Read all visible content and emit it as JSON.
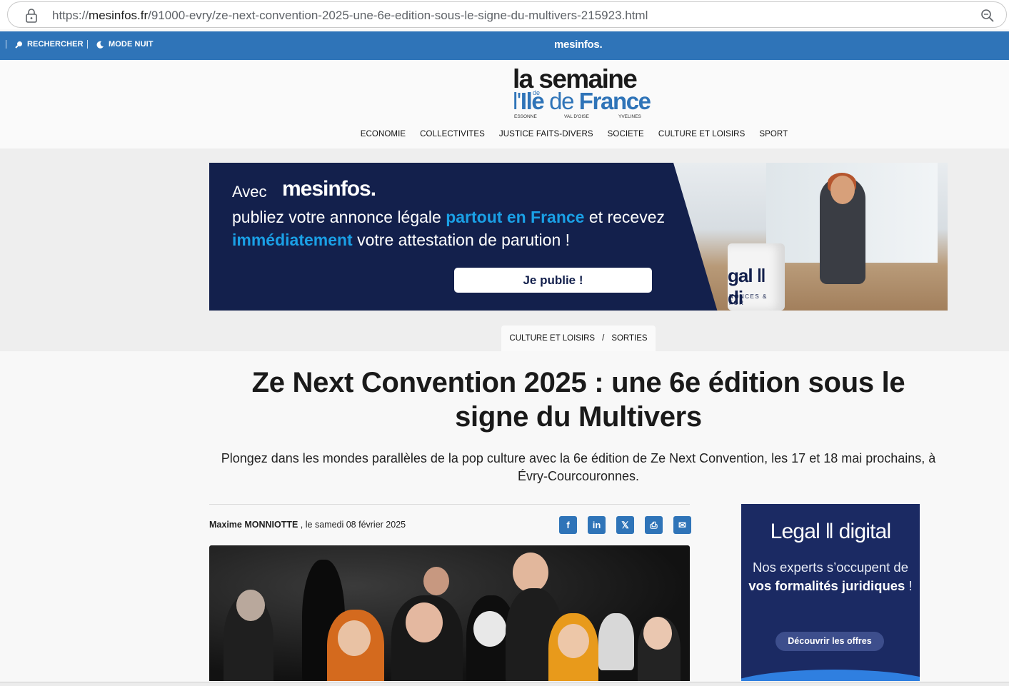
{
  "browser": {
    "url_prefix": "https://",
    "url_domain": "mesinfos.fr",
    "url_path": "/91000-evry/ze-next-convention-2025-une-6e-edition-sous-le-signe-du-multivers-215923.html"
  },
  "topbar": {
    "search_label": "RECHERCHER",
    "night_label": "MODE NUIT",
    "logo": "mesinfos.",
    "bg_color": "#2f74b8"
  },
  "site_logo": {
    "line1": "la semaine",
    "de_small": "de",
    "line2_a": "l'",
    "line2_b": "Ile",
    "line2_c": " de ",
    "line2_d": "France",
    "sub1": "ESSONNE",
    "sub2": "VAL D'OISE",
    "sub3": "YVELINES"
  },
  "nav": [
    "ECONOMIE",
    "COLLECTIVITES",
    "JUSTICE FAITS-DIVERS",
    "SOCIETE",
    "CULTURE ET LOISIRS",
    "SPORT"
  ],
  "banner_ad": {
    "avec": "Avec",
    "brand": "mesinfos.",
    "text_1": "publiez votre annonce légale ",
    "text_hl_1": "partout en France",
    "text_2": " et recevez ",
    "text_hl_2": "immédiatement",
    "text_3": " votre attestation de parution !",
    "button": "Je publie !",
    "mug_text": "gal ‖ di",
    "mug_sub": "NONCES & FOR"
  },
  "breadcrumb": {
    "item1": "CULTURE ET LOISIRS",
    "sep": "/",
    "item2": "SORTIES"
  },
  "article": {
    "title": "Ze Next Convention 2025 : une 6e édition sous le signe du Multivers",
    "lead": "Plongez dans les mondes parallèles de la pop culture avec la 6e édition de Ze Next Convention, les 17 et 18 mai prochains, à Évry-Courcouronnes.",
    "author": "Maxime MONNIOTTE",
    "date": " , le samedi 08 février 2025"
  },
  "share_icons": [
    {
      "icon": "facebook-icon",
      "glyph": "f"
    },
    {
      "icon": "linkedin-icon",
      "glyph": "in"
    },
    {
      "icon": "x-icon",
      "glyph": "𝕏"
    },
    {
      "icon": "print-icon",
      "glyph": "⎙"
    },
    {
      "icon": "mail-icon",
      "glyph": "✉"
    }
  ],
  "side_ad": {
    "title": "Legal ‖ digital",
    "text_1": "Nos experts s’occupent de ",
    "text_bold": "vos formalités juridiques",
    "text_2": " !",
    "button": "Découvrir les offres"
  }
}
